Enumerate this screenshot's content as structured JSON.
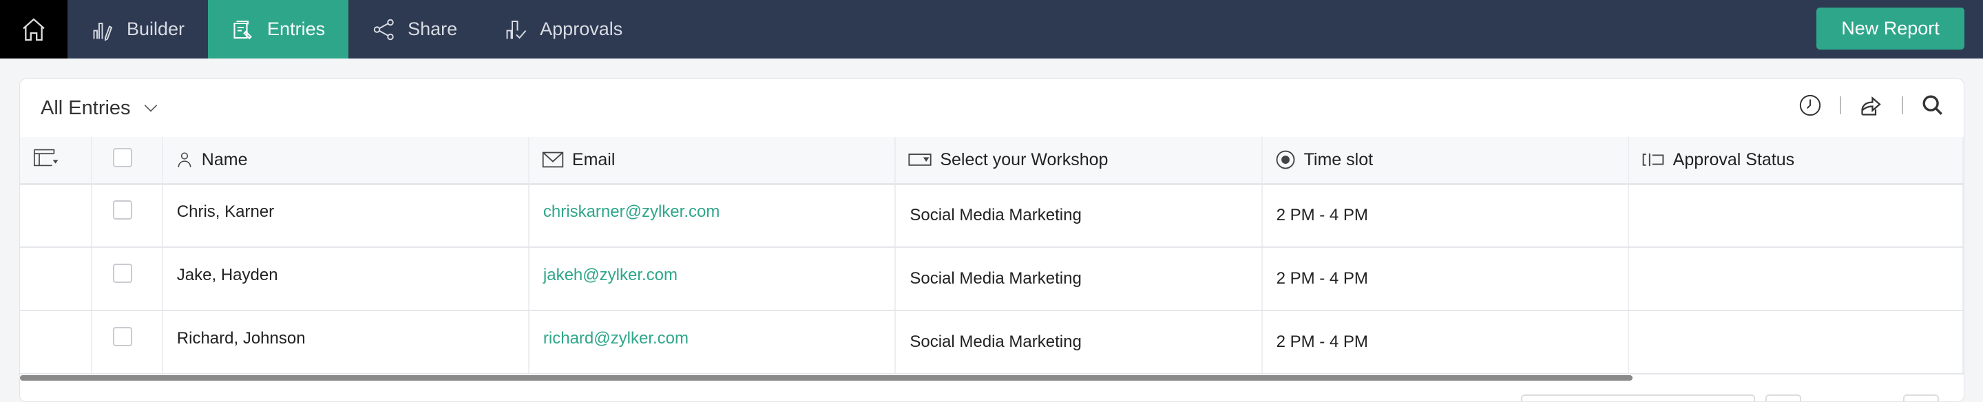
{
  "nav": {
    "tabs": [
      {
        "label": "Builder",
        "icon": "builder-icon"
      },
      {
        "label": "Entries",
        "icon": "entries-icon",
        "active": true
      },
      {
        "label": "Share",
        "icon": "share-icon"
      },
      {
        "label": "Approvals",
        "icon": "approvals-icon"
      }
    ],
    "new_report": "New Report"
  },
  "report": {
    "view": "All Entries"
  },
  "colors": {
    "accent": "#2ea68a",
    "nav_bg": "#2e3a52"
  },
  "table": {
    "columns": [
      "Name",
      "Email",
      "Select your Workshop",
      "Time slot",
      "Approval Status"
    ],
    "rows": [
      {
        "name": "Chris, Karner",
        "email": "chriskarner@zylker.com",
        "workshop": "Social Media Marketing",
        "time": "2 PM - 4 PM",
        "approval": ""
      },
      {
        "name": "Jake, Hayden",
        "email": "jakeh@zylker.com",
        "workshop": "Social Media Marketing",
        "time": "2 PM - 4 PM",
        "approval": ""
      },
      {
        "name": "Richard, Johnson",
        "email": "richard@zylker.com",
        "workshop": "Social Media Marketing",
        "time": "2 PM - 4 PM",
        "approval": ""
      }
    ]
  }
}
